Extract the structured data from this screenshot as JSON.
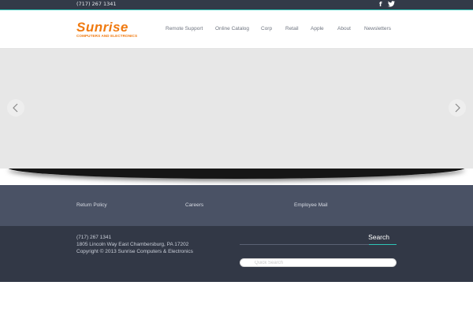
{
  "topbar": {
    "phone": "(717) 267 1341",
    "social": [
      {
        "icon": "facebook-icon",
        "glyph": "f"
      },
      {
        "icon": "twitter-icon",
        "glyph": "🐦"
      }
    ]
  },
  "header": {
    "logo_word": "Sunrise",
    "logo_tagline": "COMPUTERS AND ELECTRONICS",
    "nav": [
      "Remote Support",
      "Online Catalog",
      "Corp",
      "Retail",
      "Apple",
      "About",
      "Newsletters"
    ]
  },
  "slider": {
    "prev_icon": "chevron-left-icon",
    "next_icon": "chevron-right-icon"
  },
  "footer_links": [
    "Return Policy",
    "Careers",
    "Employee Mail"
  ],
  "footer_info": {
    "phone": "(717) 267 1341",
    "address": "1805 Lincoln Way East Chambersburg, PA 17202",
    "copyright": "Copyright © 2013 Sunrise Computers & Electronics"
  },
  "search": {
    "title": "Search",
    "placeholder": "Quick Search"
  },
  "colors": {
    "brand": "#f07a10",
    "accent": "#2ec4b6",
    "topbar_bg": "#333a48",
    "links_band_bg": "#4a5265",
    "bottom_bg": "#323846"
  }
}
